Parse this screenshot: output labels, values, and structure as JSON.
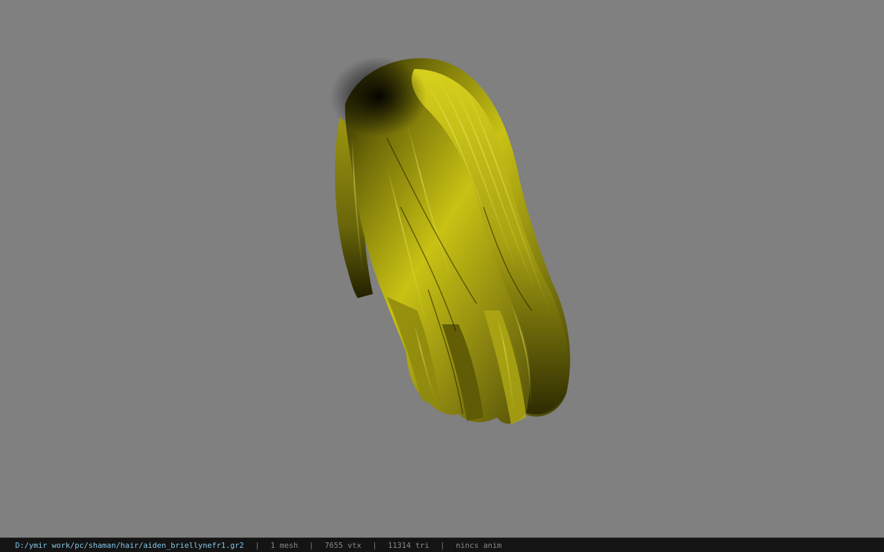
{
  "viewer": {
    "background_color": "#808080",
    "model_color": "#c8c214",
    "model_icon": "hair-mesh"
  },
  "status": {
    "file_path": "D:/ymir work/pc/shaman/hair/aiden_briellynefr1.gr2",
    "separator": "|",
    "mesh_count": "1 mesh",
    "vertex_count": "7655 vtx",
    "triangle_count": "11314 tri",
    "anim_status": "nincs anim"
  }
}
